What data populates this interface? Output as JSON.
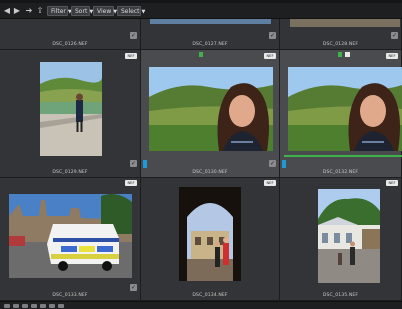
{
  "toolbar": {
    "nav_icons": [
      "back-arrow-icon",
      "forward-arrow-icon",
      "next-arrow-icon",
      "up-arrow-icon"
    ],
    "filter_label": "Filter",
    "sort_label": "Sort",
    "view_label": "View",
    "select_label": "Select"
  },
  "row0": [
    {
      "filename": "DSC_0126.NEF"
    },
    {
      "filename": "DSC_0127.NEF"
    },
    {
      "filename": "DSC_0128.NEF"
    }
  ],
  "row1": [
    {
      "filename": "DSC_0129.NEF",
      "badge": "NEF"
    },
    {
      "filename": "DSC_0130.NEF",
      "badge": "NEF"
    },
    {
      "filename": "DSC_0132.NEF",
      "badge": "NEF"
    }
  ],
  "row2": [
    {
      "filename": "DSC_0133.NEF",
      "badge": "NEF"
    },
    {
      "filename": "DSC_0134.NEF",
      "badge": "NEF"
    },
    {
      "filename": "DSC_0135.NEF",
      "badge": "NEF"
    }
  ],
  "colors": {
    "selection_bg": "#4a4b4e",
    "green_label": "#3fb24b",
    "blue_label": "#1e9bd7"
  }
}
